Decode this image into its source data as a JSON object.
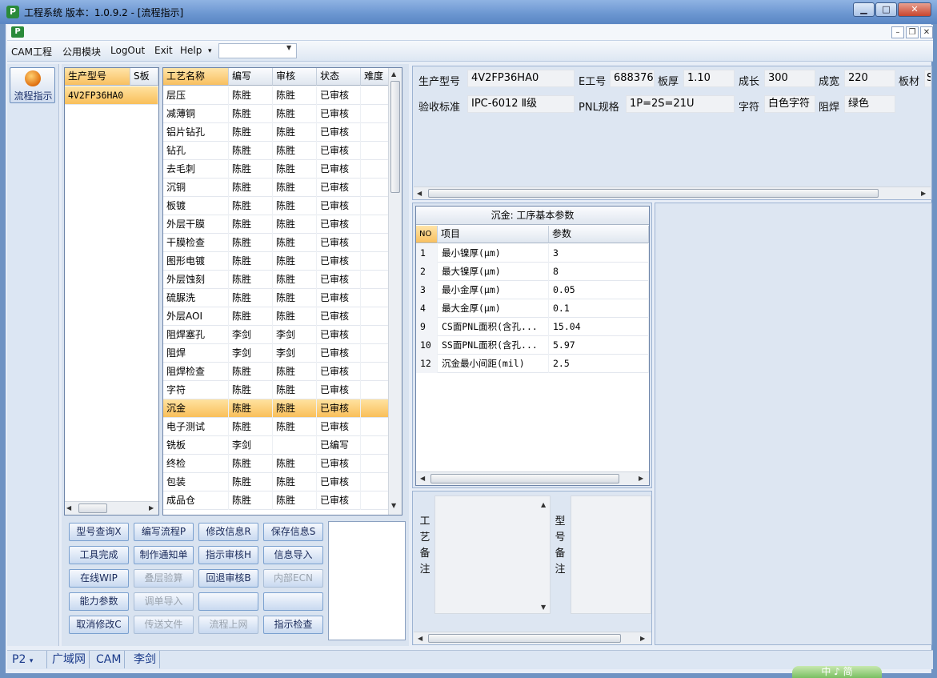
{
  "window": {
    "title": "工程系统  版本：1.0.9.2 - [流程指示]"
  },
  "menu": {
    "items": [
      "CAM工程",
      "公用模块",
      "LogOut",
      "Exit",
      "Help"
    ],
    "help_arrow": "▾"
  },
  "nav": {
    "flow_label": "流程指示"
  },
  "model_grid": {
    "headers": [
      "生产型号",
      "S板"
    ],
    "rows": [
      [
        "4V2FP36HA0",
        ""
      ]
    ]
  },
  "process_grid": {
    "headers": [
      "工艺名称",
      "编写",
      "审核",
      "状态",
      "难度"
    ],
    "selected_index": 17,
    "rows": [
      [
        "层压",
        "陈胜",
        "陈胜",
        "已审核",
        ""
      ],
      [
        "减薄铜",
        "陈胜",
        "陈胜",
        "已审核",
        ""
      ],
      [
        "铝片钻孔",
        "陈胜",
        "陈胜",
        "已审核",
        ""
      ],
      [
        "钻孔",
        "陈胜",
        "陈胜",
        "已审核",
        ""
      ],
      [
        "去毛刺",
        "陈胜",
        "陈胜",
        "已审核",
        ""
      ],
      [
        "沉铜",
        "陈胜",
        "陈胜",
        "已审核",
        ""
      ],
      [
        "板镀",
        "陈胜",
        "陈胜",
        "已审核",
        ""
      ],
      [
        "外层干膜",
        "陈胜",
        "陈胜",
        "已审核",
        ""
      ],
      [
        "干膜检查",
        "陈胜",
        "陈胜",
        "已审核",
        ""
      ],
      [
        "图形电镀",
        "陈胜",
        "陈胜",
        "已审核",
        ""
      ],
      [
        "外层蚀刻",
        "陈胜",
        "陈胜",
        "已审核",
        ""
      ],
      [
        "硫脲洗",
        "陈胜",
        "陈胜",
        "已审核",
        ""
      ],
      [
        "外层AOI",
        "陈胜",
        "陈胜",
        "已审核",
        ""
      ],
      [
        "阻焊塞孔",
        "李剑",
        "李剑",
        "已审核",
        ""
      ],
      [
        "阻焊",
        "李剑",
        "李剑",
        "已审核",
        ""
      ],
      [
        "阻焊检查",
        "陈胜",
        "陈胜",
        "已审核",
        ""
      ],
      [
        "字符",
        "陈胜",
        "陈胜",
        "已审核",
        ""
      ],
      [
        "沉金",
        "陈胜",
        "陈胜",
        "已审核",
        ""
      ],
      [
        "电子测试",
        "陈胜",
        "陈胜",
        "已审核",
        ""
      ],
      [
        "铣板",
        "李剑",
        "",
        "已编写",
        ""
      ],
      [
        "终检",
        "陈胜",
        "陈胜",
        "已审核",
        ""
      ],
      [
        "包装",
        "陈胜",
        "陈胜",
        "已审核",
        ""
      ],
      [
        "成品仓",
        "陈胜",
        "陈胜",
        "已审核",
        ""
      ]
    ]
  },
  "buttons": [
    {
      "label": "型号查询X",
      "enabled": true
    },
    {
      "label": "编写流程P",
      "enabled": true
    },
    {
      "label": "修改信息R",
      "enabled": true
    },
    {
      "label": "保存信息S",
      "enabled": true
    },
    {
      "label": "工具完成",
      "enabled": true
    },
    {
      "label": "制作通知单",
      "enabled": true
    },
    {
      "label": "指示审核H",
      "enabled": true
    },
    {
      "label": "信息导入",
      "enabled": true
    },
    {
      "label": "在线WIP",
      "enabled": true
    },
    {
      "label": "叠层验算",
      "enabled": false
    },
    {
      "label": "回退审核B",
      "enabled": true
    },
    {
      "label": "内部ECN",
      "enabled": false
    },
    {
      "label": "能力参数",
      "enabled": true
    },
    {
      "label": "调单导入",
      "enabled": false
    },
    {
      "label": "",
      "enabled": true
    },
    {
      "label": "",
      "enabled": true
    },
    {
      "label": "取消修改C",
      "enabled": true
    },
    {
      "label": "传送文件",
      "enabled": false
    },
    {
      "label": "流程上网",
      "enabled": false
    },
    {
      "label": "指示检查",
      "enabled": true
    }
  ],
  "info": {
    "prod_model_label": "生产型号",
    "prod_model": "4V2FP36HA0",
    "e_no_label": "E工号",
    "e_no": "688376",
    "thickness_label": "板厚",
    "thickness": "1.10",
    "length_label": "成长",
    "length": "300",
    "width_label": "成宽",
    "width": "220",
    "material_label": "板材",
    "material": "S",
    "standard_label": "验收标准",
    "standard": "IPC-6012 Ⅱ级",
    "pnl_label": "PNL规格",
    "pnl": "1P=2S=21U",
    "char_label": "字符",
    "char": "白色字符",
    "mask_label": "阻焊",
    "mask": "绿色"
  },
  "params": {
    "title": "沉金: 工序基本参数",
    "headers": [
      "NO",
      "项目",
      "参数"
    ],
    "rows": [
      [
        "1",
        "最小镍厚(μm)",
        "3"
      ],
      [
        "2",
        "最大镍厚(μm)",
        "8"
      ],
      [
        "3",
        "最小金厚(μm)",
        "0.05"
      ],
      [
        "4",
        "最大金厚(μm)",
        "0.1"
      ],
      [
        "9",
        "CS面PNL面积(含孔...",
        "15.04"
      ],
      [
        "10",
        "SS面PNL面积(含孔...",
        "5.97"
      ],
      [
        "12",
        "沉金最小间距(mil)",
        "2.5"
      ]
    ]
  },
  "notes": {
    "process_label": "工艺备注",
    "model_label": "型号备注"
  },
  "status": {
    "items": [
      "P2",
      "广域网",
      "CAM",
      "李剑"
    ],
    "p2_arrow": "▾"
  },
  "badge": {
    "text": "中 ♪ 简"
  }
}
